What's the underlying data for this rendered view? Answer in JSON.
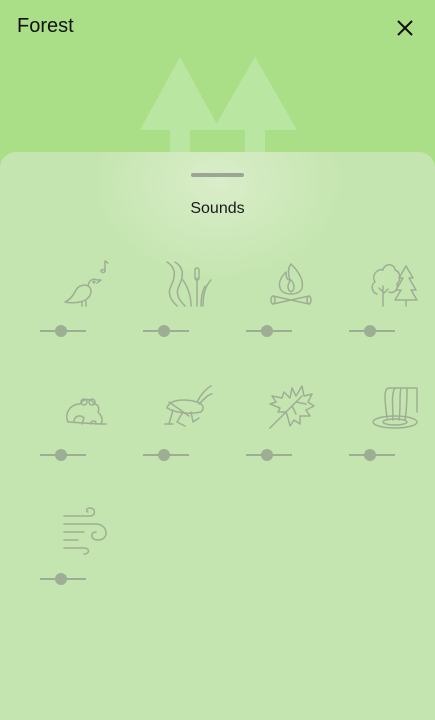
{
  "header": {
    "title": "Forest"
  },
  "sheet": {
    "title": "Sounds"
  },
  "sounds": [
    {
      "icon": "bird-icon",
      "volume": 0.45
    },
    {
      "icon": "reeds-icon",
      "volume": 0.45
    },
    {
      "icon": "campfire-icon",
      "volume": 0.45
    },
    {
      "icon": "trees-icon",
      "volume": 0.45
    },
    {
      "icon": "frog-icon",
      "volume": 0.45
    },
    {
      "icon": "cricket-icon",
      "volume": 0.45
    },
    {
      "icon": "maple-leaf-icon",
      "volume": 0.45
    },
    {
      "icon": "waterfall-icon",
      "volume": 0.45
    },
    {
      "icon": "wind-icon",
      "volume": 0.45
    }
  ],
  "colors": {
    "background": "#abdf87",
    "sheet": "#c4e5af",
    "icon": "#9eae95"
  }
}
